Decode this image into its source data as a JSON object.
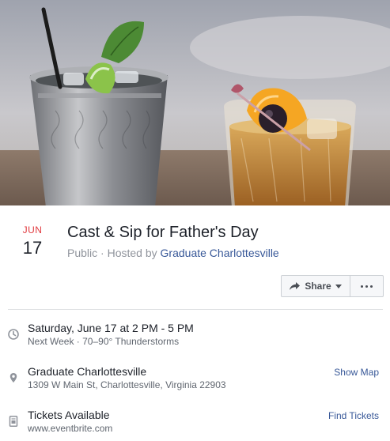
{
  "event": {
    "month": "JUN",
    "day": "17",
    "title": "Cast & Sip for Father's Day",
    "privacy": "Public",
    "separator": " · ",
    "hosted_by_prefix": "Hosted by ",
    "host": "Graduate Charlottesville"
  },
  "actions": {
    "share_label": "Share",
    "share_icon": "share-arrow-icon",
    "more_icon": "more-dots-icon"
  },
  "details": {
    "time": {
      "icon": "clock-icon",
      "main": "Saturday, June 17 at 2 PM - 5 PM",
      "sub": "Next Week · 70–90° Thunderstorms"
    },
    "location": {
      "icon": "map-pin-icon",
      "main": "Graduate Charlottesville",
      "sub": "1309 W Main St, Charlottesville, Virginia 22903",
      "action": "Show Map"
    },
    "tickets": {
      "icon": "ticket-icon",
      "main": "Tickets Available",
      "sub": "www.eventbrite.com",
      "action": "Find Tickets"
    }
  },
  "colors": {
    "month_red": "#e0393e",
    "link_blue": "#385898",
    "muted_gray": "#90949c",
    "button_bg": "#f6f7f9"
  }
}
